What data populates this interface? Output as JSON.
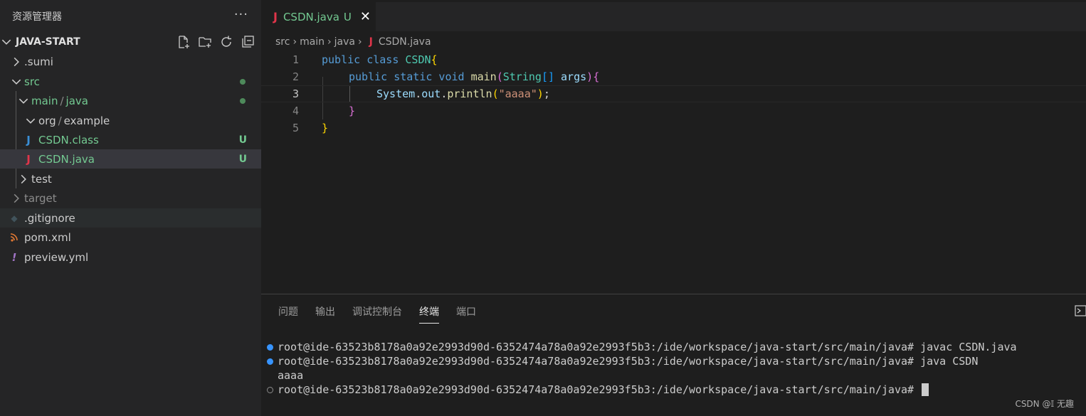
{
  "sidebar": {
    "title": "资源管理器",
    "more": "···",
    "project": "JAVA-START",
    "tree": [
      {
        "label": ".sumi",
        "badge": ""
      },
      {
        "label": "src",
        "badge": ""
      },
      {
        "label": "main",
        "label2": "java",
        "badge": ""
      },
      {
        "label": "org",
        "label2": "example",
        "badge": ""
      },
      {
        "icon": "J",
        "label": "CSDN.class",
        "badge": "U"
      },
      {
        "icon": "J",
        "label": "CSDN.java",
        "badge": "U"
      },
      {
        "label": "test",
        "badge": ""
      },
      {
        "label": "target",
        "badge": ""
      },
      {
        "icon": "◆",
        "label": ".gitignore",
        "badge": ""
      },
      {
        "icon": "⌇",
        "label": "pom.xml",
        "badge": ""
      },
      {
        "icon": "!",
        "label": "preview.yml",
        "badge": ""
      }
    ],
    "path_sep": "/"
  },
  "editor": {
    "tab": {
      "icon": "J",
      "name": "CSDN.java",
      "status": "U",
      "close": "✕"
    },
    "breadcrumb": [
      "src",
      "main",
      "java",
      "CSDN.java"
    ],
    "breadcrumb_icon": "J",
    "line_numbers": [
      "1",
      "2",
      "3",
      "4",
      "5"
    ],
    "code": {
      "l1_kw": "public class ",
      "l1_cls": "CSDN",
      "l1_brace": "{",
      "l2_kw": "public static void ",
      "l2_fn": "main",
      "l2_paren": "(",
      "l2_type": "String",
      "l2_arr": "[]",
      "l2_arg": " args",
      "l2_close": ")",
      "l2_brace": "{",
      "l3_obj": "System",
      "l3_dot": ".",
      "l3_field": "out",
      "l3_dot2": ".",
      "l3_fn": "println",
      "l3_open": "(",
      "l3_str": "\"aaaa\"",
      "l3_close": ")",
      "l3_semi": ";",
      "l4_brace": "}",
      "l5_brace": "}"
    }
  },
  "panel": {
    "tabs": [
      "问题",
      "输出",
      "调试控制台",
      "终端",
      "端口"
    ],
    "active_tab": "终端",
    "terminal": [
      "root@ide-63523b8178a0a92e2993d90d-6352474a78a0a92e2993f5b3:/ide/workspace/java-start/src/main/java# javac CSDN.java",
      "root@ide-63523b8178a0a92e2993d90d-6352474a78a0a92e2993f5b3:/ide/workspace/java-start/src/main/java# java CSDN",
      "aaaa",
      "root@ide-63523b8178a0a92e2993d90d-6352474a78a0a92e2993f5b3:/ide/workspace/java-start/src/main/java# "
    ]
  },
  "watermark": "CSDN @𝕀 无趣",
  "colors": {
    "git_untracked": "#73c991",
    "java_icon": "#e0354a",
    "class_icon": "#3a8fd6",
    "status_dot": "#3794ff"
  }
}
